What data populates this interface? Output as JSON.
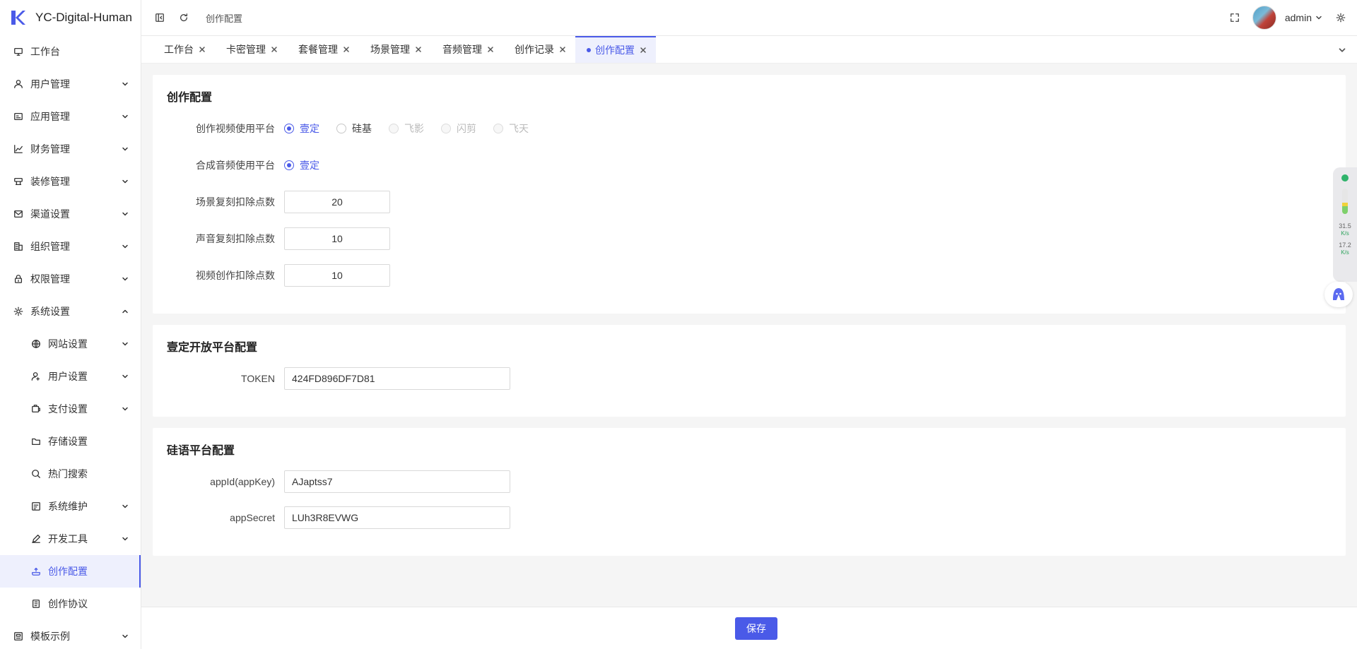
{
  "app": {
    "title": "YC-Digital-Human",
    "brand_color": "#4a5ae8"
  },
  "sidebar": {
    "items": [
      {
        "label": "工作台",
        "icon": "monitor-icon",
        "arrow": false
      },
      {
        "label": "用户管理",
        "icon": "user-icon",
        "arrow": true
      },
      {
        "label": "应用管理",
        "icon": "app-icon",
        "arrow": true
      },
      {
        "label": "财务管理",
        "icon": "chart-icon",
        "arrow": true
      },
      {
        "label": "装修管理",
        "icon": "decor-icon",
        "arrow": true
      },
      {
        "label": "渠道设置",
        "icon": "mail-icon",
        "arrow": true
      },
      {
        "label": "组织管理",
        "icon": "building-icon",
        "arrow": true
      },
      {
        "label": "权限管理",
        "icon": "lock-icon",
        "arrow": true
      },
      {
        "label": "系统设置",
        "icon": "gear-icon",
        "arrow": "up"
      }
    ],
    "sub_items": [
      {
        "label": "网站设置",
        "icon": "globe-icon",
        "arrow": true
      },
      {
        "label": "用户设置",
        "icon": "user-settings-icon",
        "arrow": true
      },
      {
        "label": "支付设置",
        "icon": "payment-icon",
        "arrow": true
      },
      {
        "label": "存储设置",
        "icon": "folder-icon",
        "arrow": false
      },
      {
        "label": "热门搜索",
        "icon": "search-icon",
        "arrow": false
      },
      {
        "label": "系统维护",
        "icon": "maintenance-icon",
        "arrow": true
      },
      {
        "label": "开发工具",
        "icon": "pen-icon",
        "arrow": true
      },
      {
        "label": "创作配置",
        "icon": "creation-icon",
        "arrow": false,
        "active": true
      },
      {
        "label": "创作协议",
        "icon": "document-icon",
        "arrow": false
      }
    ],
    "last_item": {
      "label": "模板示例",
      "icon": "template-icon",
      "arrow": true
    }
  },
  "header": {
    "breadcrumb": "创作配置",
    "username": "admin"
  },
  "tabs": [
    {
      "label": "工作台"
    },
    {
      "label": "卡密管理"
    },
    {
      "label": "套餐管理"
    },
    {
      "label": "场景管理"
    },
    {
      "label": "音频管理"
    },
    {
      "label": "创作记录"
    },
    {
      "label": "创作配置",
      "active": true
    }
  ],
  "creation_config": {
    "title": "创作配置",
    "video_platform": {
      "label": "创作视频使用平台",
      "options": [
        "壹定",
        "硅基",
        "飞影",
        "闪剪",
        "飞天"
      ],
      "selected": "壹定"
    },
    "audio_platform": {
      "label": "合成音频使用平台",
      "options": [
        "壹定"
      ],
      "selected": "壹定"
    },
    "scene_clone_points": {
      "label": "场景复刻扣除点数",
      "value": "20"
    },
    "voice_clone_points": {
      "label": "声音复刻扣除点数",
      "value": "10"
    },
    "video_creation_points": {
      "label": "视频创作扣除点数",
      "value": "10"
    }
  },
  "yiding_config": {
    "title": "壹定开放平台配置",
    "token": {
      "label": "TOKEN",
      "value": "424FD896DF7D81"
    }
  },
  "guiyu_config": {
    "title": "硅语平台配置",
    "app_id": {
      "label": "appId(appKey)",
      "value": "AJaptss7"
    },
    "app_secret": {
      "label": "appSecret",
      "value": "LUh3R8EVWG"
    }
  },
  "footer": {
    "save_label": "保存"
  },
  "widget": {
    "upload_speed": "31.5",
    "download_speed": "17.2",
    "speed_unit": "K/s"
  }
}
